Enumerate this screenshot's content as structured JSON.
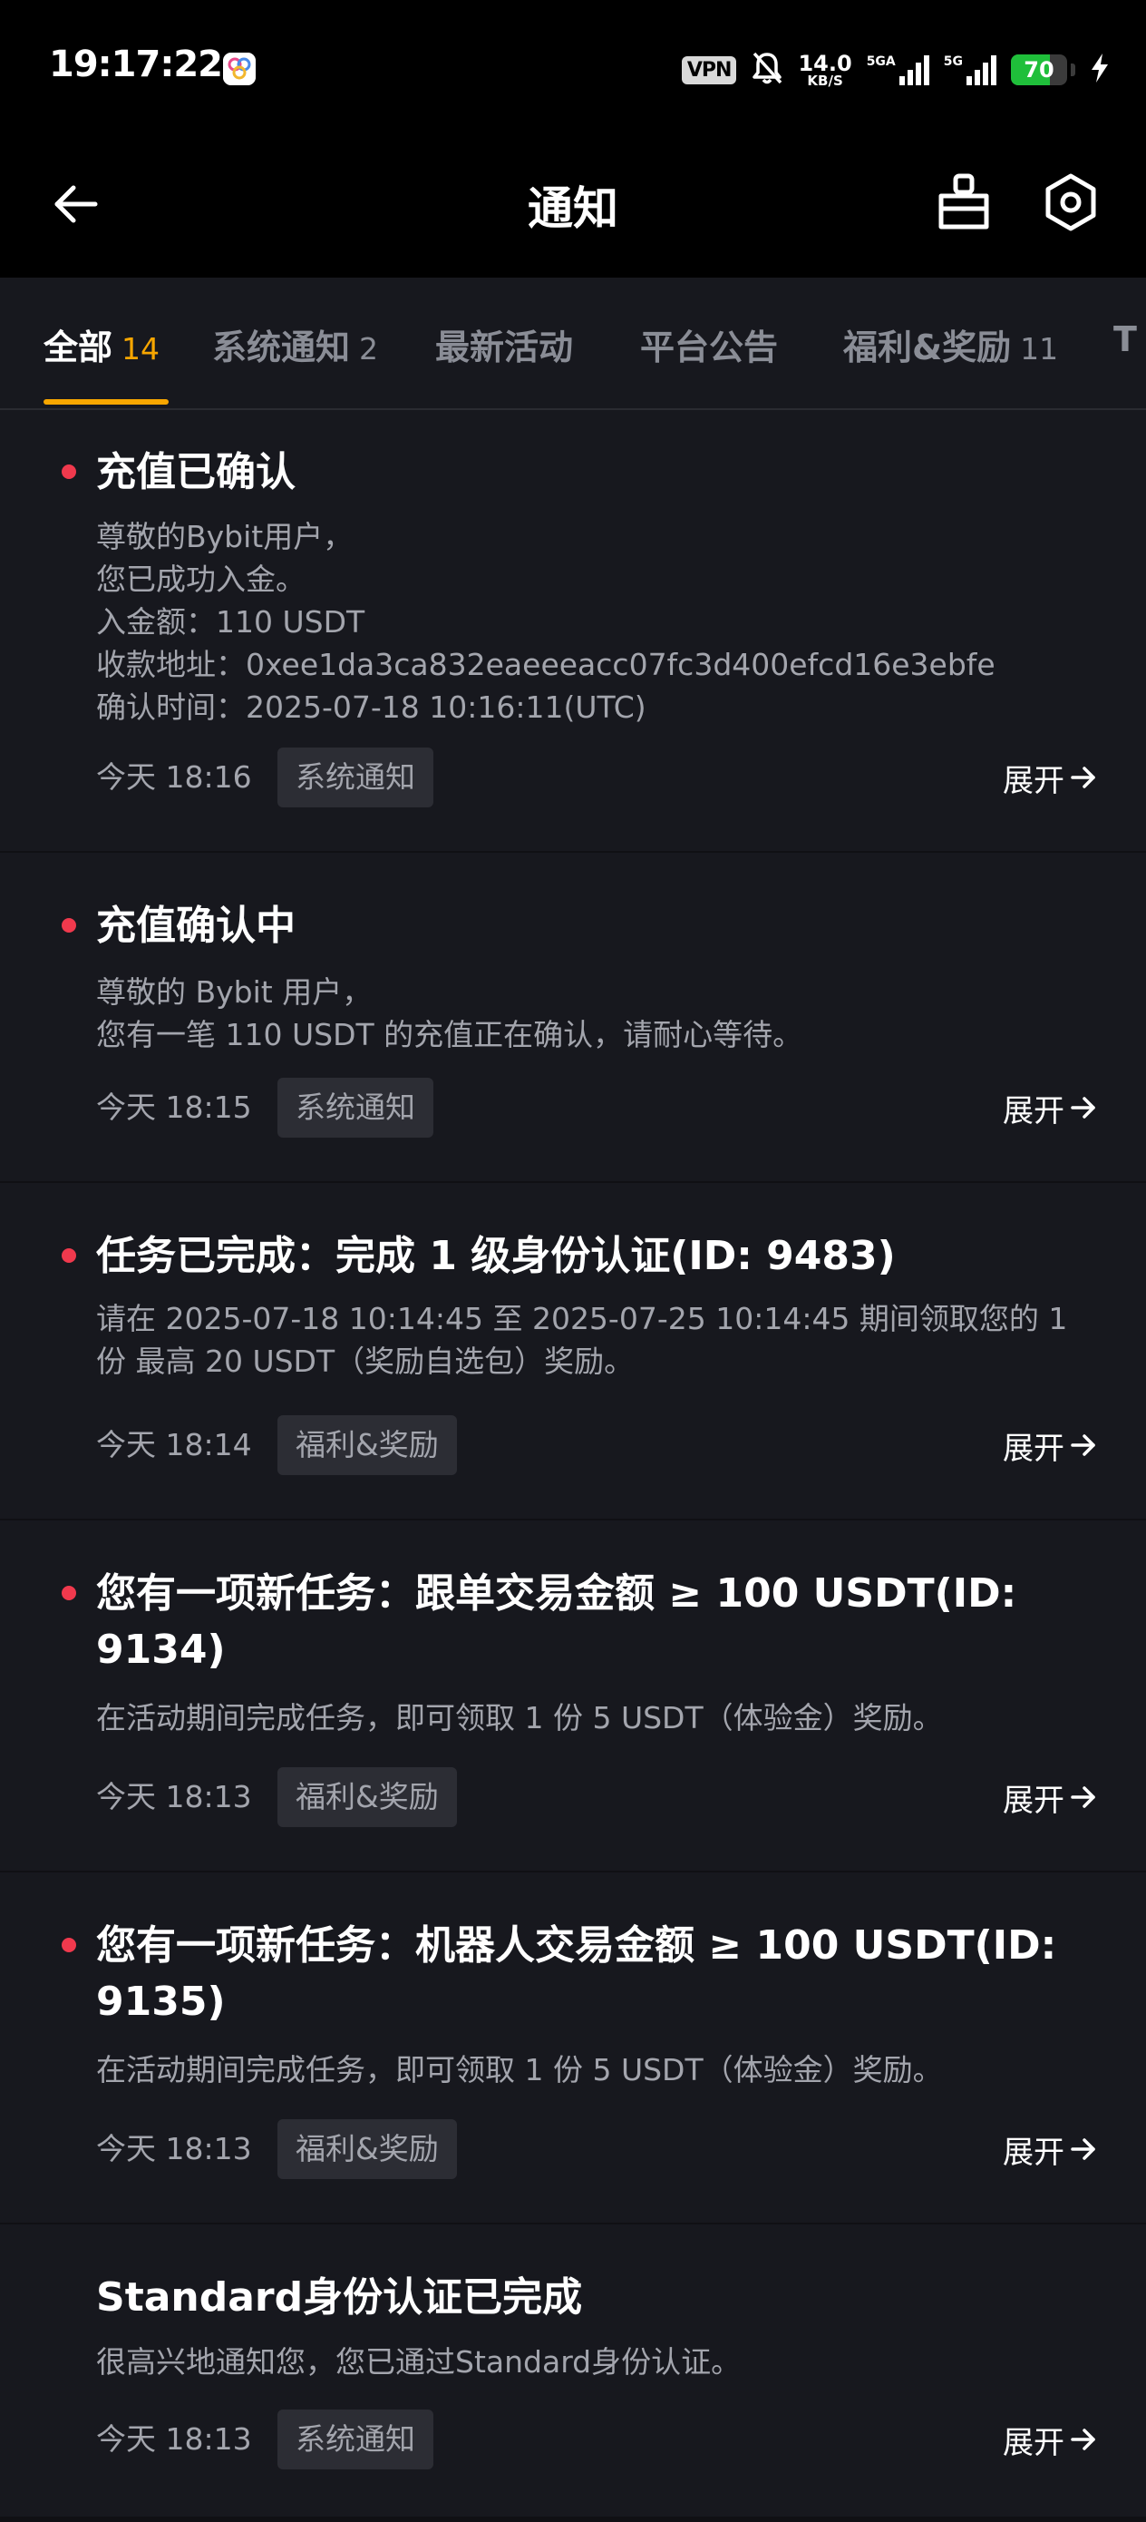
{
  "status_bar": {
    "time": "19:17:22",
    "vpn": "VPN",
    "net_speed_value": "14.0",
    "net_speed_unit": "KB/S",
    "signal1_label": "5GA",
    "signal2_label": "5G",
    "battery_level": "70",
    "battery_fraction": 0.7,
    "icons": [
      "app-icon",
      "mute-bell-icon",
      "signal-icon",
      "signal-icon",
      "battery-icon",
      "charging-bolt-icon"
    ]
  },
  "header": {
    "title": "通知",
    "icons": [
      "back-arrow-icon",
      "broom-icon",
      "settings-icon"
    ]
  },
  "tabs": [
    {
      "label": "全部",
      "count": "14",
      "active": true
    },
    {
      "label": "系统通知",
      "count": "2",
      "active": false
    },
    {
      "label": "最新活动",
      "count": "",
      "active": false
    },
    {
      "label": "平台公告",
      "count": "",
      "active": false
    },
    {
      "label": "福利&奖励",
      "count": "11",
      "active": false
    },
    {
      "label": "T",
      "count": "",
      "active": false
    }
  ],
  "colors": {
    "accent": "#f7a600",
    "unread_dot": "#f0394d",
    "card_bg": "#17181e",
    "tag_bg": "#2c2d34",
    "muted_text": "#a3a5ad"
  },
  "notifications": [
    {
      "unread": true,
      "title": "充值已确认",
      "body": [
        "尊敬的Bybit用户，",
        "您已成功入金。",
        "入金额：110 USDT",
        "收款地址：0xee1da3ca832eaeeeacc07fc3d400efcd16e3ebfe",
        "确认时间：2025-07-18 10:16:11(UTC)"
      ],
      "time": "今天 18:16",
      "tag": "系统通知",
      "expand_label": "展开"
    },
    {
      "unread": true,
      "title": "充值确认中",
      "body": [
        "尊敬的 Bybit 用户，",
        "您有一笔 110 USDT 的充值正在确认，请耐心等待。"
      ],
      "time": "今天 18:15",
      "tag": "系统通知",
      "expand_label": "展开"
    },
    {
      "unread": true,
      "title": "任务已完成：完成 1 级身份认证(ID: 9483)",
      "body": [
        "请在 2025-07-18 10:14:45 至 2025-07-25 10:14:45 期间领取您的 1 份 最高 20 USDT（奖励自选包）奖励。"
      ],
      "time": "今天 18:14",
      "tag": "福利&奖励",
      "expand_label": "展开"
    },
    {
      "unread": true,
      "title": "您有一项新任务：跟单交易金额 ≥ 100 USDT(ID: 9134)",
      "body": [
        "在活动期间完成任务，即可领取 1 份 5 USDT（体验金）奖励。"
      ],
      "time": "今天 18:13",
      "tag": "福利&奖励",
      "expand_label": "展开"
    },
    {
      "unread": true,
      "title": "您有一项新任务：机器人交易金额 ≥ 100 USDT(ID: 9135)",
      "body": [
        "在活动期间完成任务，即可领取 1 份 5 USDT（体验金）奖励。"
      ],
      "time": "今天 18:13",
      "tag": "福利&奖励",
      "expand_label": "展开"
    },
    {
      "unread": false,
      "title": "Standard身份认证已完成",
      "body": [
        "很高兴地通知您，您已通过Standard身份认证。"
      ],
      "time": "今天 18:13",
      "tag": "系统通知",
      "expand_label": "展开"
    }
  ]
}
